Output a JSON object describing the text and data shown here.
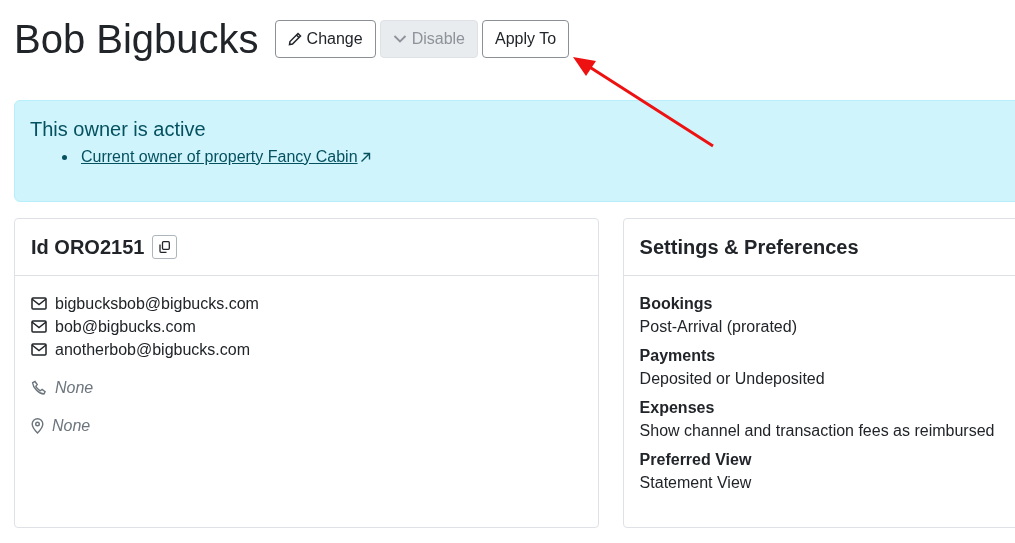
{
  "title": "Bob Bigbucks",
  "buttons": [
    {
      "label": "Change",
      "disabled": false
    },
    {
      "label": "Disable",
      "disabled": true
    },
    {
      "label": "Apply To",
      "disabled": false
    }
  ],
  "alert": {
    "heading": "This owner is active",
    "links": [
      "Current owner of property Fancy Cabin"
    ]
  },
  "id_card": {
    "title": "Id ORO2151",
    "contacts": [
      {
        "kind": "email",
        "value": "bigbucksbob@bigbucks.com",
        "missing": false
      },
      {
        "kind": "email",
        "value": "bob@bigbucks.com",
        "missing": false
      },
      {
        "kind": "email",
        "value": "anotherbob@bigbucks.com",
        "missing": false
      },
      {
        "kind": "phone",
        "value": "None",
        "missing": true
      },
      {
        "kind": "address",
        "value": "None",
        "missing": true
      }
    ]
  },
  "settings": {
    "title": "Settings & Preferences",
    "items": [
      {
        "label": "Bookings",
        "value": "Post-Arrival (prorated)"
      },
      {
        "label": "Payments",
        "value": "Deposited or Undeposited"
      },
      {
        "label": "Expenses",
        "value": "Show channel and transaction fees as reimbursed"
      },
      {
        "label": "Preferred View",
        "value": "Statement View"
      }
    ]
  }
}
